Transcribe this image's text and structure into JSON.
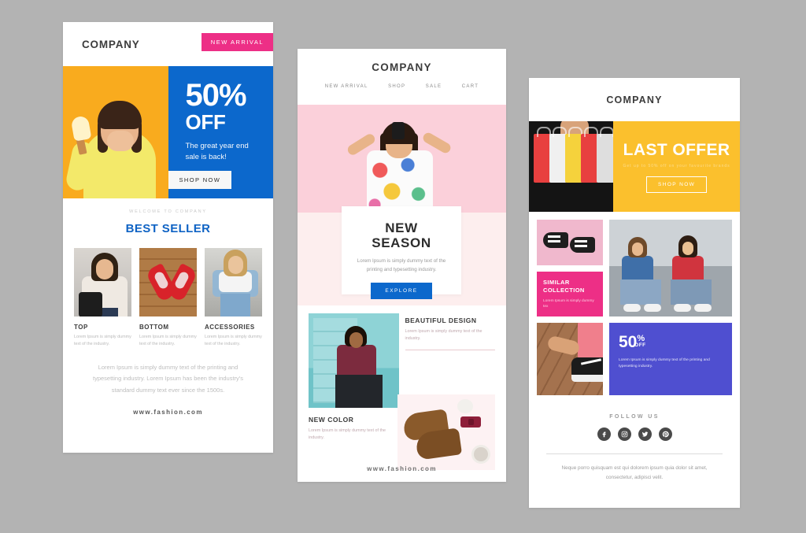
{
  "panel1": {
    "logo": "COMPANY",
    "badge": "NEW ARRIVAL",
    "hero": {
      "percent": "50%",
      "off": "OFF",
      "subtitle": "The great year end sale is back!",
      "cta": "SHOP NOW"
    },
    "welcome": "WELCOME TO COMPANY",
    "section_title": "BEST SELLER",
    "products": [
      {
        "title": "TOP",
        "desc": "Lorem Ipsum is simply dummy text of the industry."
      },
      {
        "title": "BOTTOM",
        "desc": "Lorem Ipsum is simply dummy text of the industry."
      },
      {
        "title": "ACCESSORIES",
        "desc": "Lorem Ipsum is simply dummy text of the industry."
      }
    ],
    "footer_text": "Lorem Ipsum is simply dummy text of the printing and typesetting industry. Lorem Ipsum has been the industry's standard dummy text ever since the 1500s.",
    "url": "www.fashion.com"
  },
  "panel2": {
    "logo": "COMPANY",
    "nav": [
      "NEW ARRIVAL",
      "SHOP",
      "SALE",
      "CART"
    ],
    "card": {
      "title_line1": "NEW",
      "title_line2": "SEASON",
      "desc": "Lorem Ipsum is simply dummy text of the printing and typesetting industry.",
      "cta": "EXPLORE"
    },
    "blocks": [
      {
        "title": "BEAUTIFUL DESIGN",
        "desc": "Lorem Ipsum is simply dummy text of the industry."
      },
      {
        "title": "NEW COLOR",
        "desc": "Lorem Ipsum is simply dummy text of the industry."
      }
    ],
    "url": "www.fashion.com"
  },
  "panel3": {
    "logo": "COMPANY",
    "hero": {
      "title": "LAST OFFER",
      "subtitle": "Get up to 50% off on your favourite brands",
      "cta": "SHOP NOW"
    },
    "similar": {
      "title_line1": "SIMILAR",
      "title_line2": "COLLECTION",
      "desc": "Lorem Ipsum is simply dummy tex"
    },
    "offer": {
      "number": "50",
      "percent": "%",
      "off": "OFF",
      "desc": "Lorem Ipsum is simply dummy text of the printing and typesetting industry."
    },
    "follow_title": "FOLLOW US",
    "socials": [
      {
        "name": "facebook-icon",
        "glyph": "f"
      },
      {
        "name": "instagram-icon",
        "glyph": "▣"
      },
      {
        "name": "twitter-icon",
        "glyph": "ᵗ"
      },
      {
        "name": "pinterest-icon",
        "glyph": "P"
      }
    ],
    "footer_text": "Neque porro quisquam est qui dolorem ipsum quia dolor sit amet, consectetur, adipisci velit."
  },
  "colors": {
    "background": "#b3b3b3",
    "blue": "#0c68cc",
    "pink": "#ed2f86",
    "yellow": "#f9ab1e",
    "amber": "#fbc02d",
    "purple": "#4f4fd0",
    "light_pink": "#fbd0da"
  }
}
